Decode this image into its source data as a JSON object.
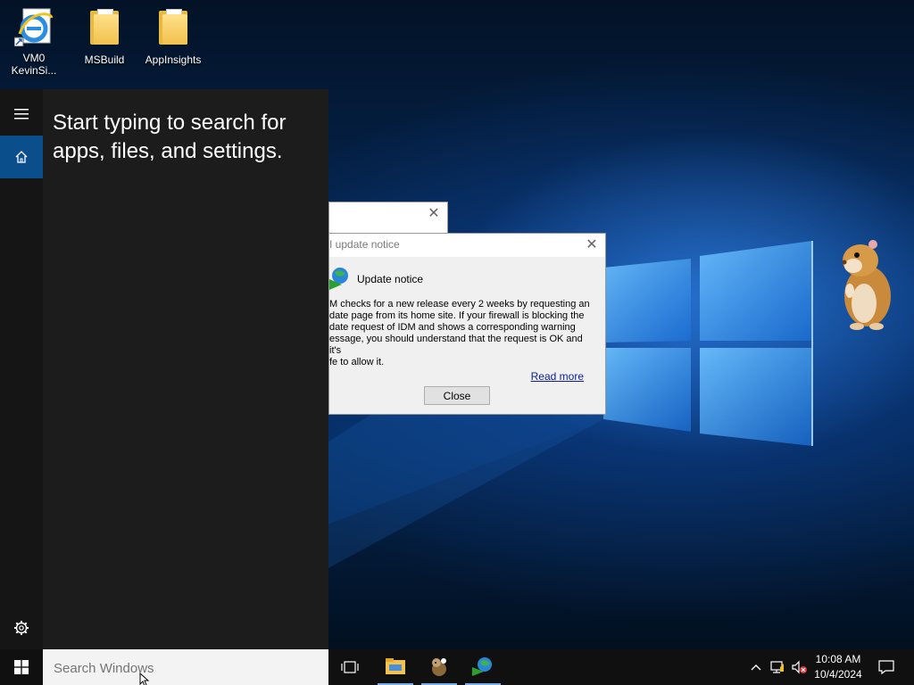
{
  "desktop": {
    "icons": [
      {
        "label_line1": "VM0",
        "label_line2": "KevinSi...",
        "icon": "internet-explorer-icon"
      },
      {
        "label_line1": "MSBuild",
        "icon": "folder-icon"
      },
      {
        "label_line1": "AppInsights",
        "icon": "folder-icon"
      }
    ]
  },
  "start_panel": {
    "hint": "Start typing to search for apps, files, and settings.",
    "rail": [
      {
        "icon": "hamburger-menu-icon"
      },
      {
        "icon": "home-icon",
        "selected": true
      },
      {
        "icon": "gear-icon"
      }
    ]
  },
  "dialogs": {
    "background_dialog": {
      "close_glyph": "✕"
    },
    "update_notice": {
      "title": "I update notice",
      "heading": "Update notice",
      "body": "M checks for a new release every 2 weeks by requesting an\ndate page from its home site. If your firewall is blocking the\ndate request of IDM and shows a corresponding warning\nessage, you should understand that the request is OK and it's\nfe to allow it.",
      "read_more": "Read more",
      "close_button": "Close",
      "close_glyph": "✕"
    }
  },
  "taskbar": {
    "search_placeholder": "Search Windows",
    "pinned": [
      {
        "icon": "task-view-icon"
      },
      {
        "icon": "file-explorer-icon",
        "running": true
      },
      {
        "icon": "hamster-app-icon",
        "running": true
      },
      {
        "icon": "idm-icon",
        "running": true
      }
    ],
    "tray": {
      "icons": [
        "chevron-up-icon",
        "network-icon",
        "volume-muted-icon"
      ],
      "time": "10:08 AM",
      "date": "10/4/2024",
      "notification_icon": "action-center-icon"
    }
  },
  "colors": {
    "start_panel_bg": "#1c1c1c",
    "selected_rail": "#0a4f8c",
    "taskbar_bg": "#101010",
    "link": "#0a1ea0"
  }
}
